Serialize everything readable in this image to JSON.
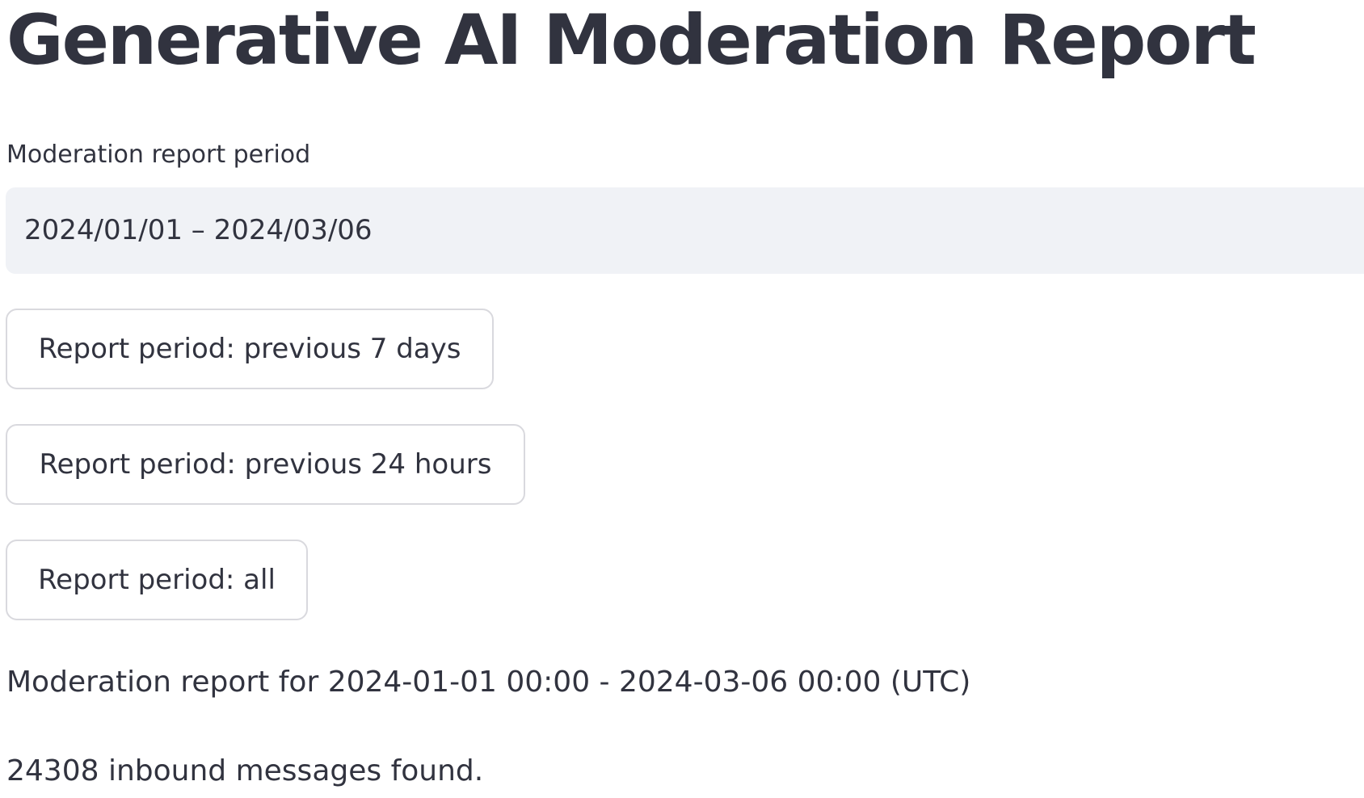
{
  "header": {
    "title": "Generative AI Moderation Report"
  },
  "period_selector": {
    "label": "Moderation report period",
    "value": "2024/01/01 – 2024/03/06"
  },
  "quick_buttons": [
    {
      "label": "Report period: previous 7 days"
    },
    {
      "label": "Report period: previous 24 hours"
    },
    {
      "label": "Report period: all"
    }
  ],
  "report": {
    "summary": "Moderation report for 2024-01-01 00:00 - 2024-03-06 00:00 (UTC)",
    "message_count": "24308 inbound messages found."
  },
  "colors": {
    "text": "#31333f",
    "input_background": "#f0f2f6",
    "button_border": "#d9d9de"
  }
}
